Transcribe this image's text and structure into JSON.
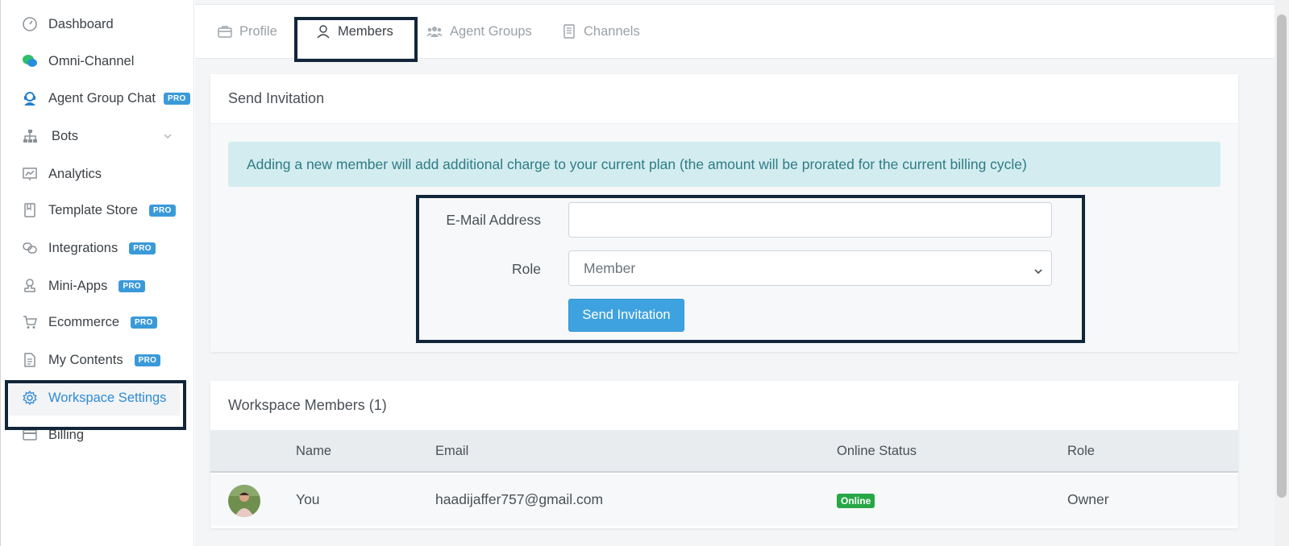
{
  "sidebar": {
    "items": [
      {
        "label": "Dashboard",
        "icon": "dashboard-gauge-icon",
        "pro": false
      },
      {
        "label": "Omni-Channel",
        "icon": "chat-bubbles-icon",
        "pro": false
      },
      {
        "label": "Agent Group Chat",
        "icon": "headset-agent-icon",
        "pro": true
      },
      {
        "label": "Bots",
        "icon": "sitemap-icon",
        "pro": false
      },
      {
        "label": "Analytics",
        "icon": "chart-board-icon",
        "pro": false
      },
      {
        "label": "Template Store",
        "icon": "book-icon",
        "pro": true
      },
      {
        "label": "Integrations",
        "icon": "link-chain-icon",
        "pro": true
      },
      {
        "label": "Mini-Apps",
        "icon": "stamp-icon",
        "pro": true
      },
      {
        "label": "Ecommerce",
        "icon": "cart-icon",
        "pro": true
      },
      {
        "label": "My Contents",
        "icon": "document-icon",
        "pro": true
      },
      {
        "label": "Workspace Settings",
        "icon": "gear-icon",
        "pro": false,
        "active": true
      },
      {
        "label": "Billing",
        "icon": "credit-card-icon",
        "pro": false
      }
    ],
    "pro_label": "PRO"
  },
  "tabs": [
    {
      "label": "Profile",
      "icon": "briefcase-icon"
    },
    {
      "label": "Members",
      "icon": "user-icon",
      "active": true
    },
    {
      "label": "Agent Groups",
      "icon": "users-group-icon"
    },
    {
      "label": "Channels",
      "icon": "notebook-icon"
    }
  ],
  "invite": {
    "title": "Send Invitation",
    "notice": "Adding a new member will add additional charge to your current plan (the amount will be prorated for the current billing cycle)",
    "email_label": "E-Mail Address",
    "email_value": "",
    "role_label": "Role",
    "role_value": "Member",
    "send_button": "Send Invitation"
  },
  "members": {
    "title": "Workspace Members (1)",
    "columns": [
      "Name",
      "Email",
      "Online Status",
      "Role"
    ],
    "rows": [
      {
        "name": "You",
        "email": "haadijaffer757@gmail.com",
        "status": "Online",
        "role": "Owner"
      }
    ]
  },
  "colors": {
    "accent": "#2f8ad6",
    "button": "#3fa2e0",
    "pro_badge": "#3a9ad9",
    "online_badge": "#27a745",
    "alert_bg": "#d3ecef",
    "highlight_border": "#12263a"
  }
}
